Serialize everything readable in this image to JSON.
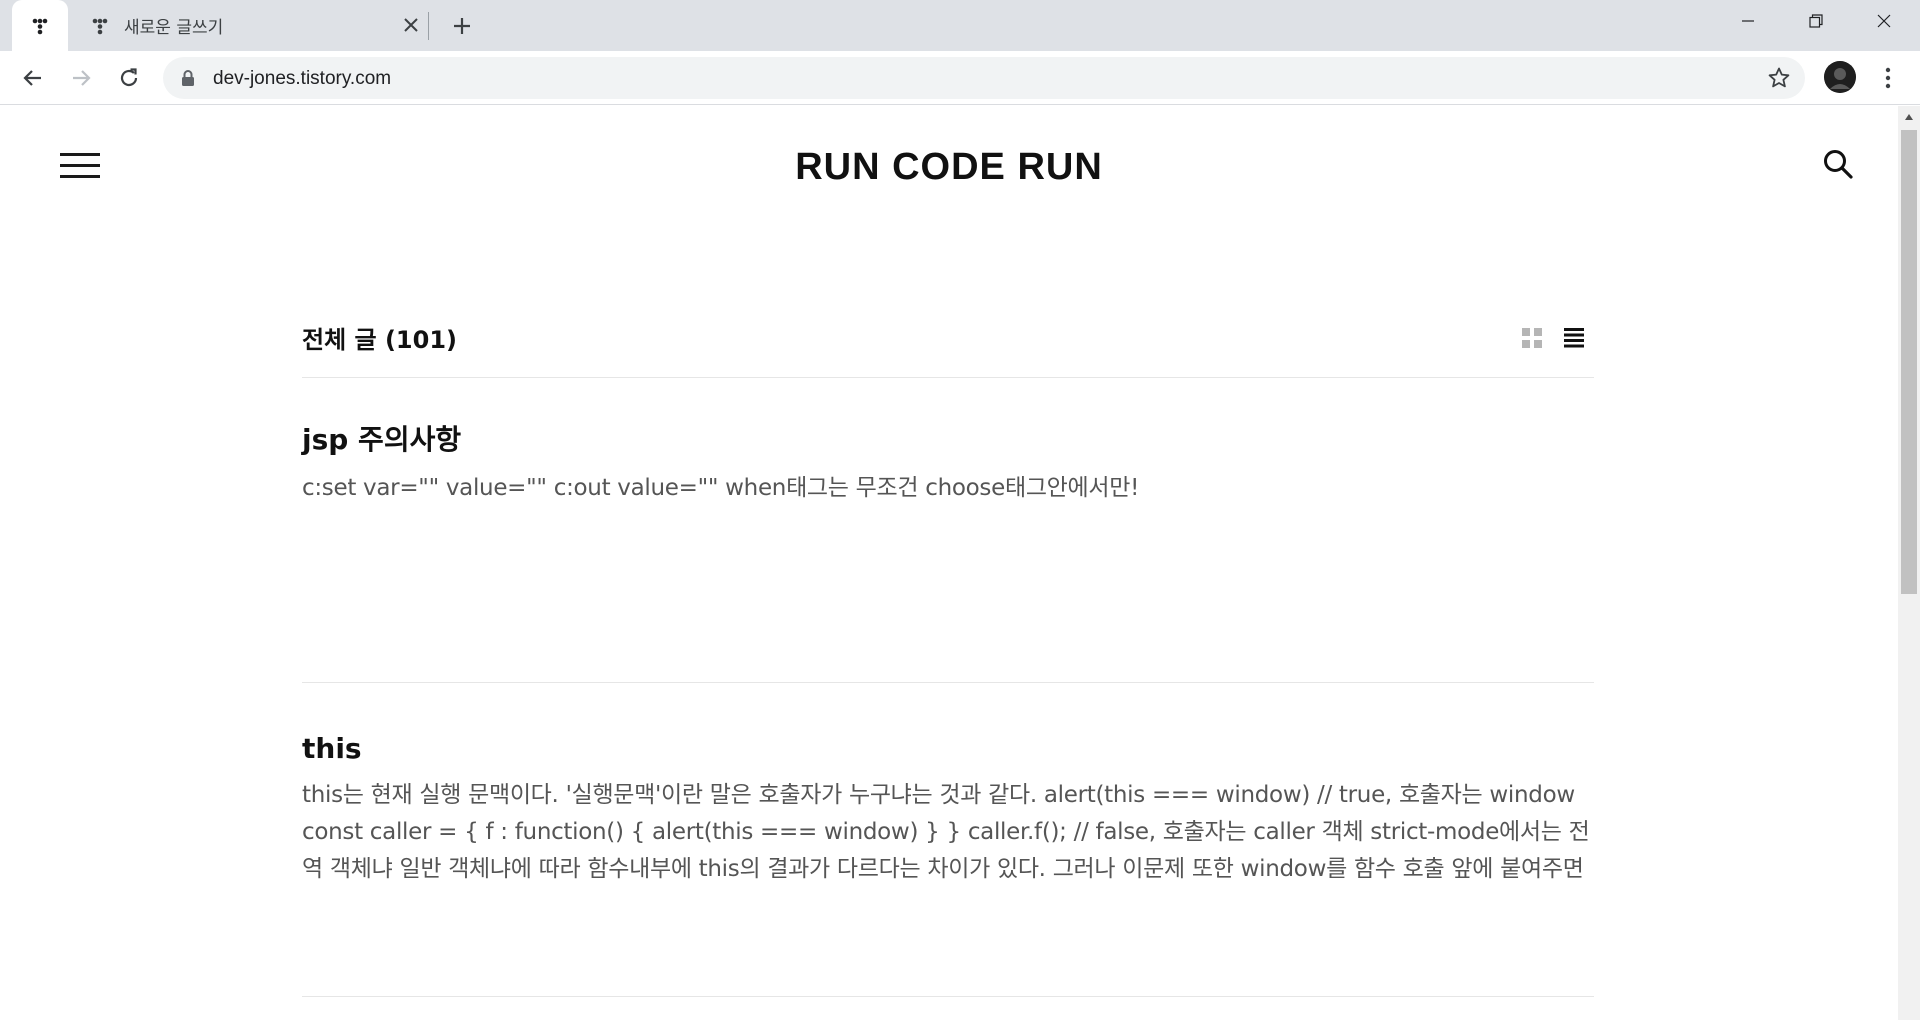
{
  "browser": {
    "tabs": [
      {
        "title": "",
        "icon": "tistory-icon",
        "active": true
      },
      {
        "title": "새로운 글쓰기",
        "icon": "tistory-icon",
        "active": false
      }
    ],
    "url": "dev-jones.tistory.com"
  },
  "site": {
    "title": "RUN CODE RUN"
  },
  "list": {
    "heading": "전체 글 (101)"
  },
  "posts": [
    {
      "title": "jsp 주의사항",
      "excerpt": "c:set var=\"\" value=\"\" c:out value=\"\" when태그는 무조건 choose태그안에서만!"
    },
    {
      "title": "this",
      "excerpt": "this는 현재 실행 문맥이다. '실행문맥'이란 말은 호출자가 누구냐는 것과 같다. alert(this === window) // true, 호출자는 window const caller = { f : function() { alert(this === window) } } caller.f(); // false, 호출자는 caller 객체 strict-mode에서는 전역 객체냐 일반 객체냐에 따라 함수내부에 this의 결과가 다르다는 차이가 있다. 그러나 이문제 또한 window를 함수 호출 앞에 붙여주면 해결된다. functio..."
    }
  ],
  "colors": {
    "tabstrip": "#dee1e6",
    "omnibox": "#f1f3f4",
    "text_dark": "#111111",
    "text_muted": "#555555",
    "divider": "#e6e6e6"
  }
}
